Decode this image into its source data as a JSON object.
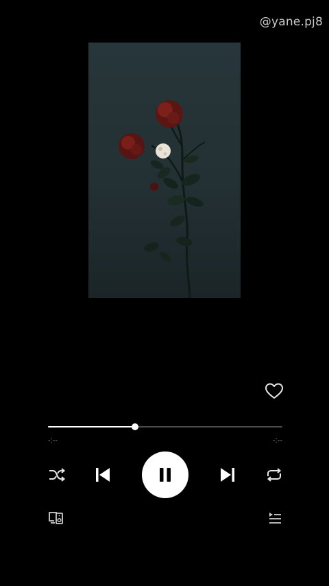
{
  "watermark": "@yane.pj8",
  "artwork": {
    "description_icon": "rose-moon-artwork-icon"
  },
  "player": {
    "progress": 0.37,
    "time_elapsed": "-:--",
    "time_total": "-:--",
    "state": "playing"
  },
  "icons": {
    "like": "heart-outline-icon",
    "shuffle": "shuffle-icon",
    "previous": "skip-previous-icon",
    "pause": "pause-icon",
    "next": "skip-next-icon",
    "repeat": "repeat-icon",
    "devices": "connect-devices-icon",
    "queue": "queue-icon"
  },
  "colors": {
    "background": "#000000",
    "accent": "#ffffff",
    "track": "#4d4d4d",
    "muted_text": "#8a8a8a"
  }
}
